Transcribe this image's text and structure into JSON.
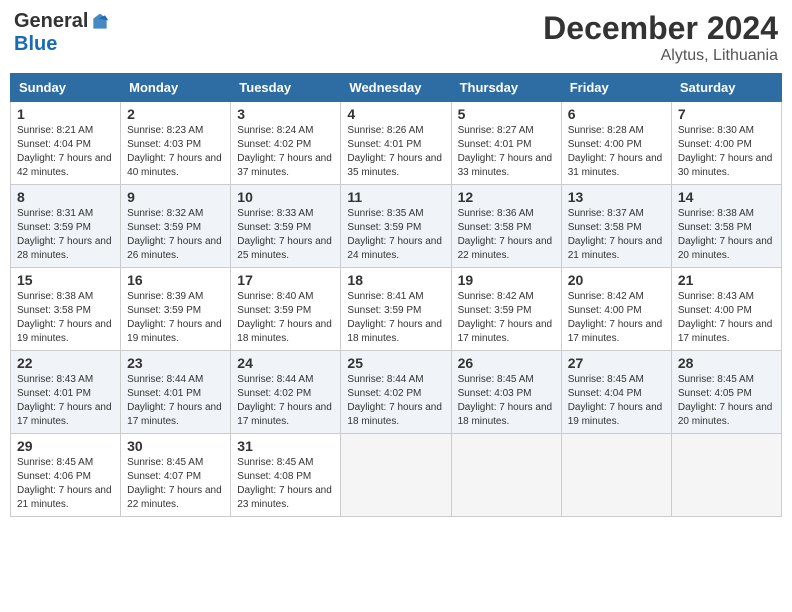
{
  "header": {
    "logo_general": "General",
    "logo_blue": "Blue",
    "title": "December 2024",
    "location": "Alytus, Lithuania"
  },
  "columns": [
    "Sunday",
    "Monday",
    "Tuesday",
    "Wednesday",
    "Thursday",
    "Friday",
    "Saturday"
  ],
  "weeks": [
    [
      {
        "day": "1",
        "sunrise": "Sunrise: 8:21 AM",
        "sunset": "Sunset: 4:04 PM",
        "daylight": "Daylight: 7 hours and 42 minutes."
      },
      {
        "day": "2",
        "sunrise": "Sunrise: 8:23 AM",
        "sunset": "Sunset: 4:03 PM",
        "daylight": "Daylight: 7 hours and 40 minutes."
      },
      {
        "day": "3",
        "sunrise": "Sunrise: 8:24 AM",
        "sunset": "Sunset: 4:02 PM",
        "daylight": "Daylight: 7 hours and 37 minutes."
      },
      {
        "day": "4",
        "sunrise": "Sunrise: 8:26 AM",
        "sunset": "Sunset: 4:01 PM",
        "daylight": "Daylight: 7 hours and 35 minutes."
      },
      {
        "day": "5",
        "sunrise": "Sunrise: 8:27 AM",
        "sunset": "Sunset: 4:01 PM",
        "daylight": "Daylight: 7 hours and 33 minutes."
      },
      {
        "day": "6",
        "sunrise": "Sunrise: 8:28 AM",
        "sunset": "Sunset: 4:00 PM",
        "daylight": "Daylight: 7 hours and 31 minutes."
      },
      {
        "day": "7",
        "sunrise": "Sunrise: 8:30 AM",
        "sunset": "Sunset: 4:00 PM",
        "daylight": "Daylight: 7 hours and 30 minutes."
      }
    ],
    [
      {
        "day": "8",
        "sunrise": "Sunrise: 8:31 AM",
        "sunset": "Sunset: 3:59 PM",
        "daylight": "Daylight: 7 hours and 28 minutes."
      },
      {
        "day": "9",
        "sunrise": "Sunrise: 8:32 AM",
        "sunset": "Sunset: 3:59 PM",
        "daylight": "Daylight: 7 hours and 26 minutes."
      },
      {
        "day": "10",
        "sunrise": "Sunrise: 8:33 AM",
        "sunset": "Sunset: 3:59 PM",
        "daylight": "Daylight: 7 hours and 25 minutes."
      },
      {
        "day": "11",
        "sunrise": "Sunrise: 8:35 AM",
        "sunset": "Sunset: 3:59 PM",
        "daylight": "Daylight: 7 hours and 24 minutes."
      },
      {
        "day": "12",
        "sunrise": "Sunrise: 8:36 AM",
        "sunset": "Sunset: 3:58 PM",
        "daylight": "Daylight: 7 hours and 22 minutes."
      },
      {
        "day": "13",
        "sunrise": "Sunrise: 8:37 AM",
        "sunset": "Sunset: 3:58 PM",
        "daylight": "Daylight: 7 hours and 21 minutes."
      },
      {
        "day": "14",
        "sunrise": "Sunrise: 8:38 AM",
        "sunset": "Sunset: 3:58 PM",
        "daylight": "Daylight: 7 hours and 20 minutes."
      }
    ],
    [
      {
        "day": "15",
        "sunrise": "Sunrise: 8:38 AM",
        "sunset": "Sunset: 3:58 PM",
        "daylight": "Daylight: 7 hours and 19 minutes."
      },
      {
        "day": "16",
        "sunrise": "Sunrise: 8:39 AM",
        "sunset": "Sunset: 3:59 PM",
        "daylight": "Daylight: 7 hours and 19 minutes."
      },
      {
        "day": "17",
        "sunrise": "Sunrise: 8:40 AM",
        "sunset": "Sunset: 3:59 PM",
        "daylight": "Daylight: 7 hours and 18 minutes."
      },
      {
        "day": "18",
        "sunrise": "Sunrise: 8:41 AM",
        "sunset": "Sunset: 3:59 PM",
        "daylight": "Daylight: 7 hours and 18 minutes."
      },
      {
        "day": "19",
        "sunrise": "Sunrise: 8:42 AM",
        "sunset": "Sunset: 3:59 PM",
        "daylight": "Daylight: 7 hours and 17 minutes."
      },
      {
        "day": "20",
        "sunrise": "Sunrise: 8:42 AM",
        "sunset": "Sunset: 4:00 PM",
        "daylight": "Daylight: 7 hours and 17 minutes."
      },
      {
        "day": "21",
        "sunrise": "Sunrise: 8:43 AM",
        "sunset": "Sunset: 4:00 PM",
        "daylight": "Daylight: 7 hours and 17 minutes."
      }
    ],
    [
      {
        "day": "22",
        "sunrise": "Sunrise: 8:43 AM",
        "sunset": "Sunset: 4:01 PM",
        "daylight": "Daylight: 7 hours and 17 minutes."
      },
      {
        "day": "23",
        "sunrise": "Sunrise: 8:44 AM",
        "sunset": "Sunset: 4:01 PM",
        "daylight": "Daylight: 7 hours and 17 minutes."
      },
      {
        "day": "24",
        "sunrise": "Sunrise: 8:44 AM",
        "sunset": "Sunset: 4:02 PM",
        "daylight": "Daylight: 7 hours and 17 minutes."
      },
      {
        "day": "25",
        "sunrise": "Sunrise: 8:44 AM",
        "sunset": "Sunset: 4:02 PM",
        "daylight": "Daylight: 7 hours and 18 minutes."
      },
      {
        "day": "26",
        "sunrise": "Sunrise: 8:45 AM",
        "sunset": "Sunset: 4:03 PM",
        "daylight": "Daylight: 7 hours and 18 minutes."
      },
      {
        "day": "27",
        "sunrise": "Sunrise: 8:45 AM",
        "sunset": "Sunset: 4:04 PM",
        "daylight": "Daylight: 7 hours and 19 minutes."
      },
      {
        "day": "28",
        "sunrise": "Sunrise: 8:45 AM",
        "sunset": "Sunset: 4:05 PM",
        "daylight": "Daylight: 7 hours and 20 minutes."
      }
    ],
    [
      {
        "day": "29",
        "sunrise": "Sunrise: 8:45 AM",
        "sunset": "Sunset: 4:06 PM",
        "daylight": "Daylight: 7 hours and 21 minutes."
      },
      {
        "day": "30",
        "sunrise": "Sunrise: 8:45 AM",
        "sunset": "Sunset: 4:07 PM",
        "daylight": "Daylight: 7 hours and 22 minutes."
      },
      {
        "day": "31",
        "sunrise": "Sunrise: 8:45 AM",
        "sunset": "Sunset: 4:08 PM",
        "daylight": "Daylight: 7 hours and 23 minutes."
      },
      null,
      null,
      null,
      null
    ]
  ]
}
